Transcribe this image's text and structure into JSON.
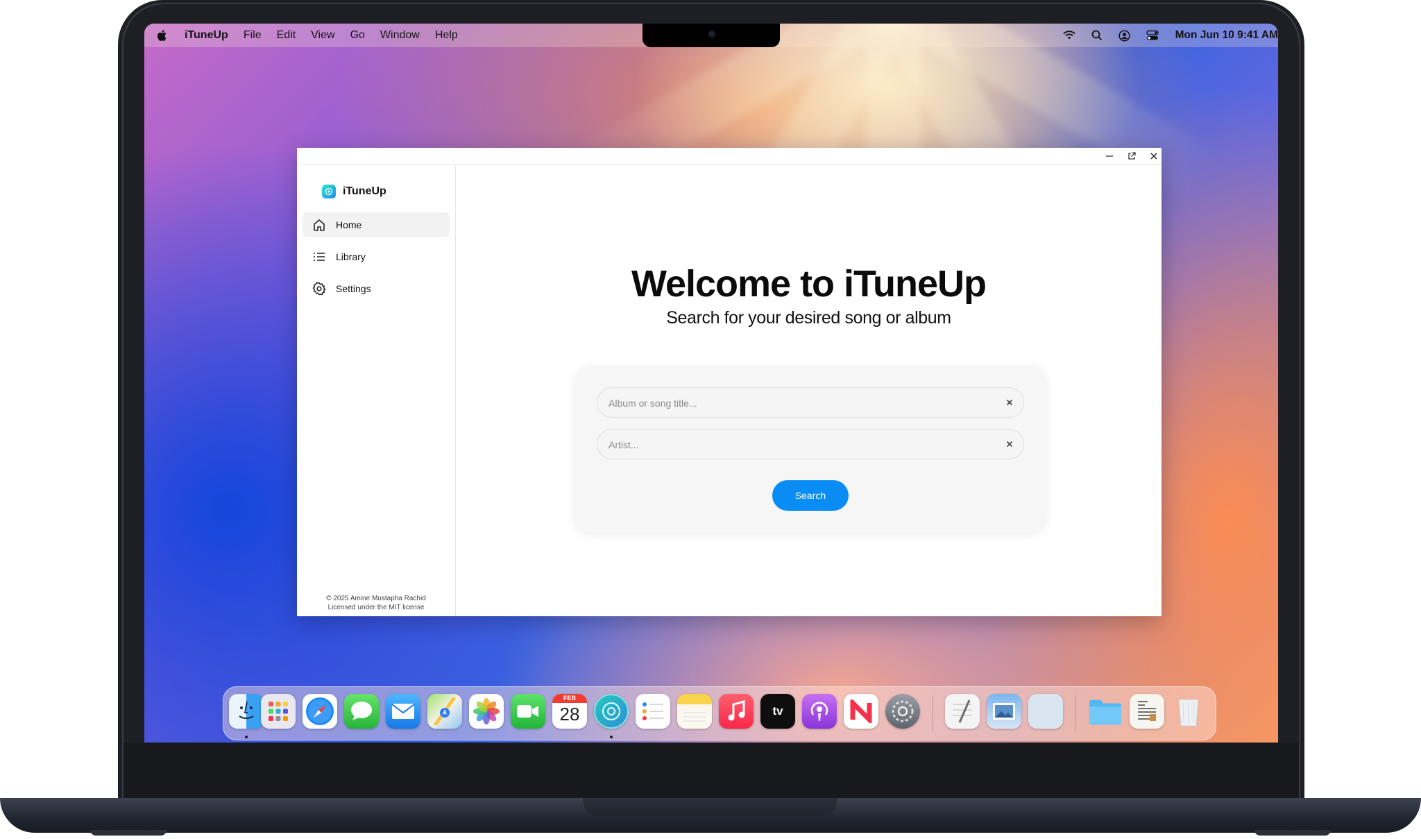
{
  "menubar": {
    "app_name": "iTuneUp",
    "items": [
      "File",
      "Edit",
      "View",
      "Go",
      "Window",
      "Help"
    ],
    "clock": "Mon Jun 10  9:41 AM"
  },
  "sidebar": {
    "brand": "iTuneUp",
    "nav": [
      {
        "label": "Home",
        "icon": "home-icon",
        "active": true
      },
      {
        "label": "Library",
        "icon": "list-icon",
        "active": false
      },
      {
        "label": "Settings",
        "icon": "gear-icon",
        "active": false
      }
    ],
    "footer_line1": "© 2025 Amine Mustapha Rachid",
    "footer_line2": "Licensed under the MIT license"
  },
  "main": {
    "title": "Welcome to iTuneUp",
    "subtitle": "Search for your desired song or album",
    "title_field": {
      "placeholder": "Album or song title...",
      "value": ""
    },
    "artist_field": {
      "placeholder": "Artist...",
      "value": ""
    },
    "search_label": "Search"
  },
  "dock": {
    "calendar_month": "FEB",
    "calendar_day": "28",
    "tv_label": "tv"
  },
  "colors": {
    "accent": "#0a8cf5",
    "brand_gradient_start": "#34e3c9",
    "brand_gradient_end": "#1a8fe8"
  }
}
